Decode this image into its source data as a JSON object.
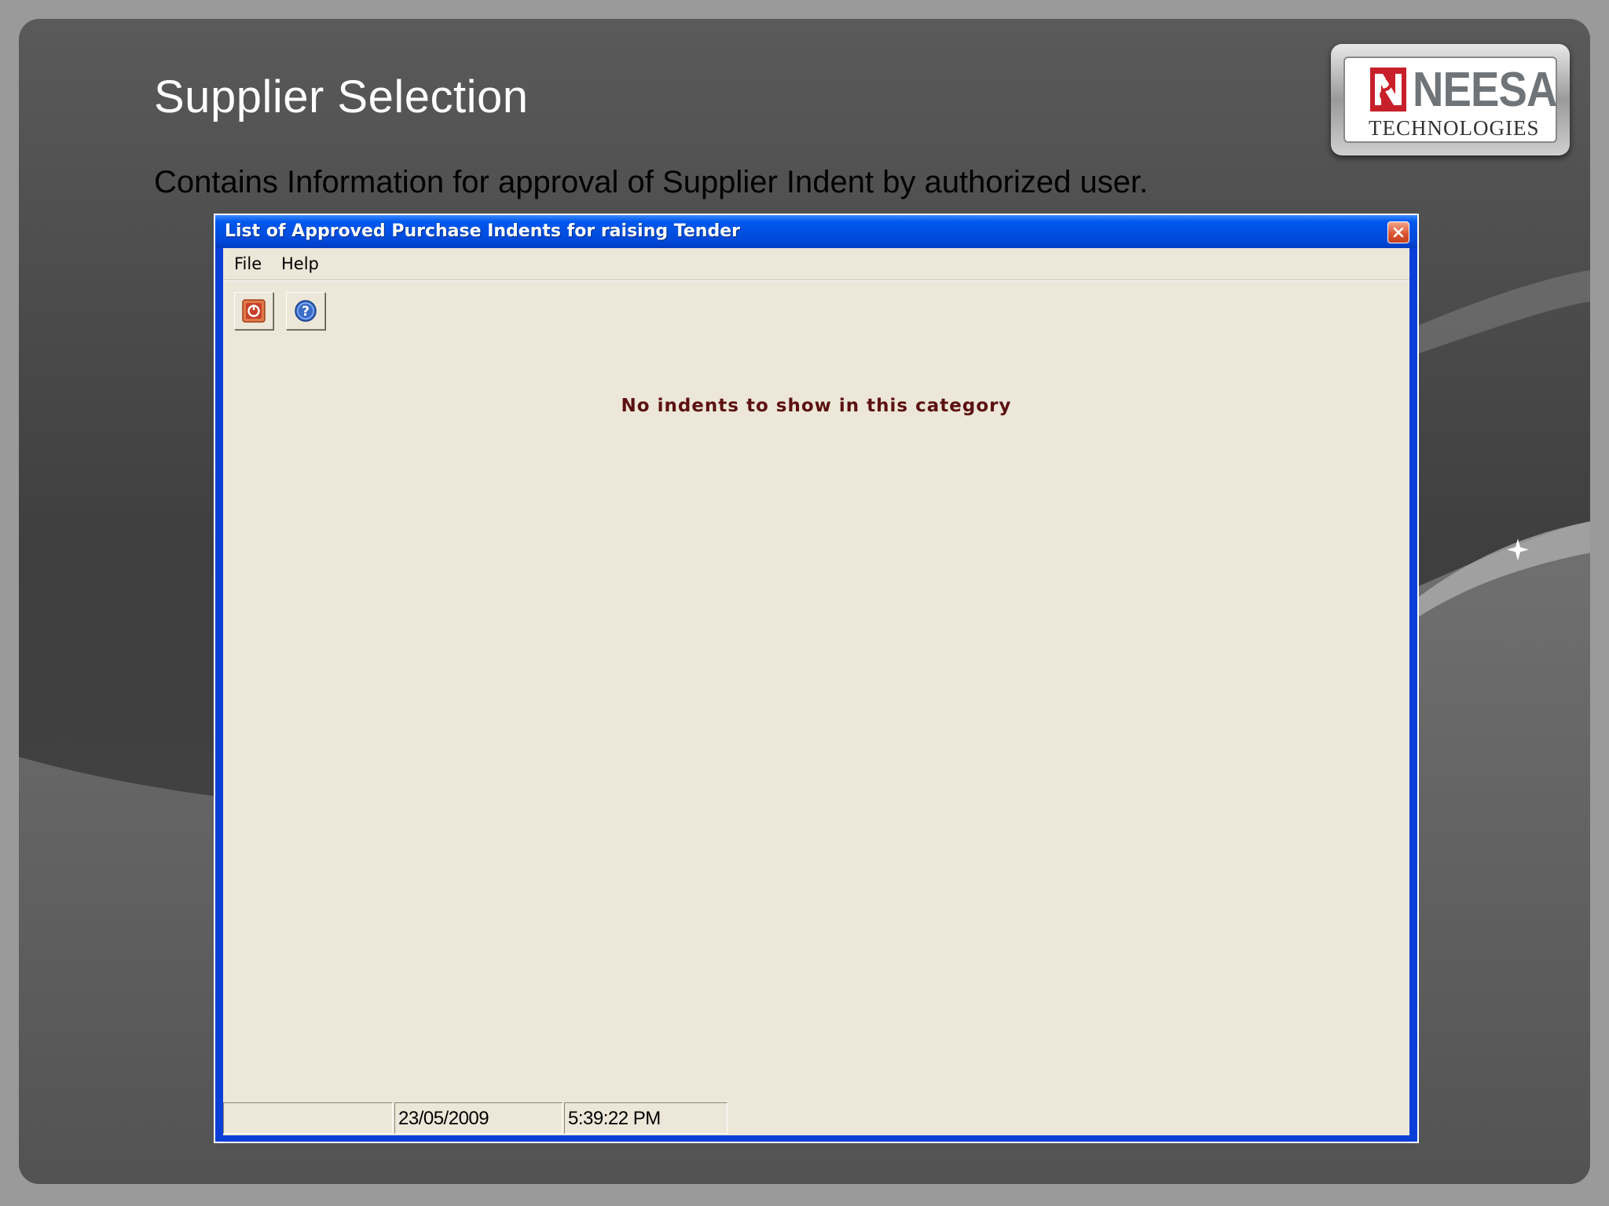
{
  "slide": {
    "title": "Supplier Selection",
    "subtitle": "Contains Information for approval of Supplier Indent by authorized user."
  },
  "logo": {
    "name": "NEESA",
    "tagline": "TECHNOLOGIES"
  },
  "window": {
    "title": "List of Approved Purchase Indents for raising Tender",
    "menu": [
      "File",
      "Help"
    ],
    "toolbar": [
      {
        "icon": "exit-icon"
      },
      {
        "icon": "help-icon"
      }
    ],
    "message": "No indents to show in this category",
    "status": {
      "cell1": "",
      "date": "23/05/2009",
      "time": "5:39:22 PM"
    }
  },
  "colors": {
    "titlebar": "#0054e3",
    "client": "#ece7d8",
    "message": "#5c1010",
    "brand_red": "#c8202a"
  }
}
